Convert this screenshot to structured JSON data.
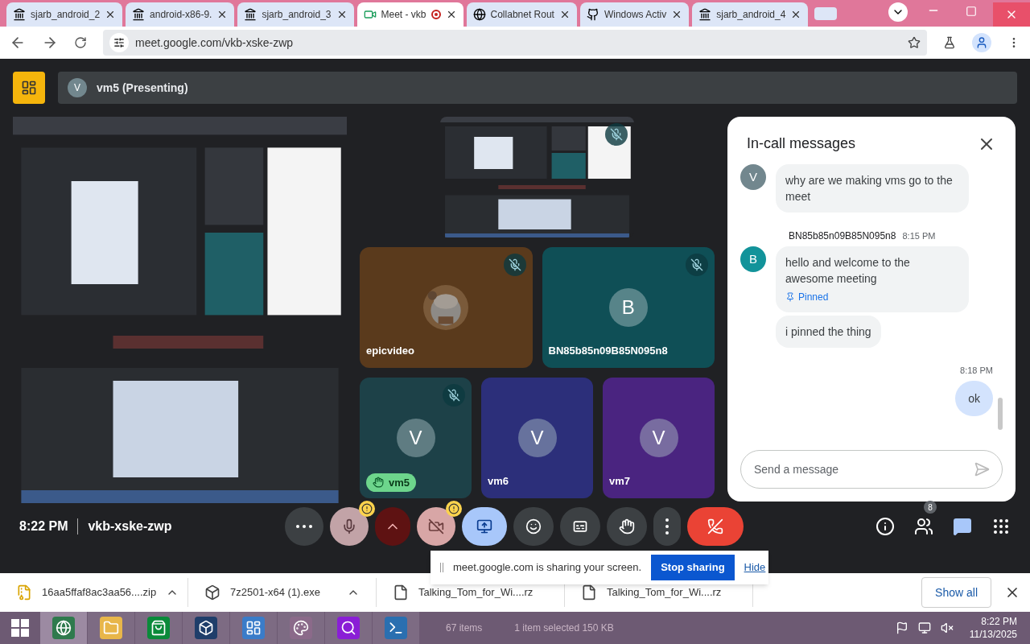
{
  "browser": {
    "tabs": [
      {
        "title": "sjarb_android_2",
        "kind": "archive",
        "selected": false,
        "recording": false
      },
      {
        "title": "android-x86-9.",
        "kind": "archive",
        "selected": false,
        "recording": false
      },
      {
        "title": "sjarb_android_3",
        "kind": "archive",
        "selected": false,
        "recording": false
      },
      {
        "title": "Meet - vkb",
        "kind": "meet",
        "selected": true,
        "recording": true
      },
      {
        "title": "Collabnet Rout",
        "kind": "globe",
        "selected": false,
        "recording": false
      },
      {
        "title": "Windows Activ",
        "kind": "github",
        "selected": false,
        "recording": false
      },
      {
        "title": "sjarb_android_4",
        "kind": "archive",
        "selected": false,
        "recording": false
      }
    ],
    "address": "meet.google.com/vkb-xske-zwp"
  },
  "meeting": {
    "presenter_bar": {
      "avatar": "V",
      "label": "vm5 (Presenting)"
    },
    "presentation_tile": {
      "muted": true
    },
    "tiles": [
      {
        "kind": "video",
        "name": "epicvideo",
        "muted": true,
        "color": "#5a3a1c",
        "hand_raised": false
      },
      {
        "kind": "avatar",
        "name": "BN85b85n09B85N095n8",
        "avatar": "B",
        "muted": true,
        "color": "#0f4f56",
        "hand_raised": false
      },
      {
        "kind": "avatar",
        "name": "vm5",
        "avatar": "V",
        "muted": true,
        "color": "#1d4148",
        "hand_raised": true
      },
      {
        "kind": "avatar",
        "name": "vm6",
        "avatar": "V",
        "muted": false,
        "color": "#2c2f7a",
        "hand_raised": false
      },
      {
        "kind": "avatar",
        "name": "vm7",
        "avatar": "V",
        "muted": false,
        "color": "#4a2480",
        "hand_raised": false
      }
    ],
    "time": "8:22 PM",
    "code": "vkb-xske-zwp",
    "controls": [
      {
        "kind": "more",
        "warning": false
      },
      {
        "kind": "mic",
        "warning": true
      },
      {
        "kind": "chevron",
        "warning": false
      },
      {
        "kind": "camera",
        "warning": true
      },
      {
        "kind": "present",
        "warning": false
      },
      {
        "kind": "emoji",
        "warning": false
      },
      {
        "kind": "captions",
        "warning": false
      },
      {
        "kind": "hand",
        "warning": false
      },
      {
        "kind": "options",
        "warning": false
      },
      {
        "kind": "end",
        "warning": false
      }
    ],
    "side_buttons": [
      {
        "kind": "info",
        "selected": false
      },
      {
        "kind": "people",
        "badge": "8",
        "selected": false
      },
      {
        "kind": "chat",
        "selected": true
      },
      {
        "kind": "activities",
        "selected": false
      }
    ],
    "chat": {
      "title": "In-call messages",
      "groups": [
        {
          "own": false,
          "avatar": "V",
          "color": "#72878e",
          "bubbles": [
            {
              "text": "why are we making vms go to the meet"
            }
          ]
        },
        {
          "own": false,
          "avatar": "B",
          "color": "#12939a",
          "sender": "BN85b85n09B85N095n8",
          "time": "8:15 PM",
          "bubbles": [
            {
              "text": "hello and welcome to the awesome meeting",
              "pinned_label": "Pinned"
            },
            {
              "text": "i pinned the thing"
            }
          ]
        },
        {
          "own": true,
          "time": "8:18 PM",
          "bubbles": [
            {
              "text": "ok"
            }
          ]
        }
      ],
      "placeholder": "Send a message"
    }
  },
  "share_notice": {
    "text": "meet.google.com is sharing your screen.",
    "stop": "Stop sharing",
    "hide": "Hide"
  },
  "downloads": {
    "items": [
      {
        "name": "16aa5ffaf8ac3aa56....zip",
        "kind": "zip",
        "menu": true
      },
      {
        "name": "7z2501-x64 (1).exe",
        "kind": "installer",
        "menu": true
      },
      {
        "name": "Talking_Tom_for_Wi....rz",
        "kind": "file",
        "menu": false
      },
      {
        "name": "Talking_Tom_for_Wi....rz",
        "kind": "file",
        "menu": false
      }
    ],
    "show_all": "Show all"
  },
  "taskbar": {
    "apps": [
      {
        "kind": "browser",
        "selected": true
      },
      {
        "kind": "folder",
        "selected": false
      },
      {
        "kind": "store",
        "selected": false
      },
      {
        "kind": "box",
        "selected": false
      },
      {
        "kind": "panel",
        "selected": false
      },
      {
        "kind": "paint",
        "selected": false
      },
      {
        "kind": "search",
        "selected": false
      },
      {
        "kind": "terminal",
        "selected": false
      }
    ],
    "behind_status": [
      "67 items",
      "1 item selected  150 KB"
    ],
    "time": "8:22 PM",
    "date": "11/13/2025"
  }
}
